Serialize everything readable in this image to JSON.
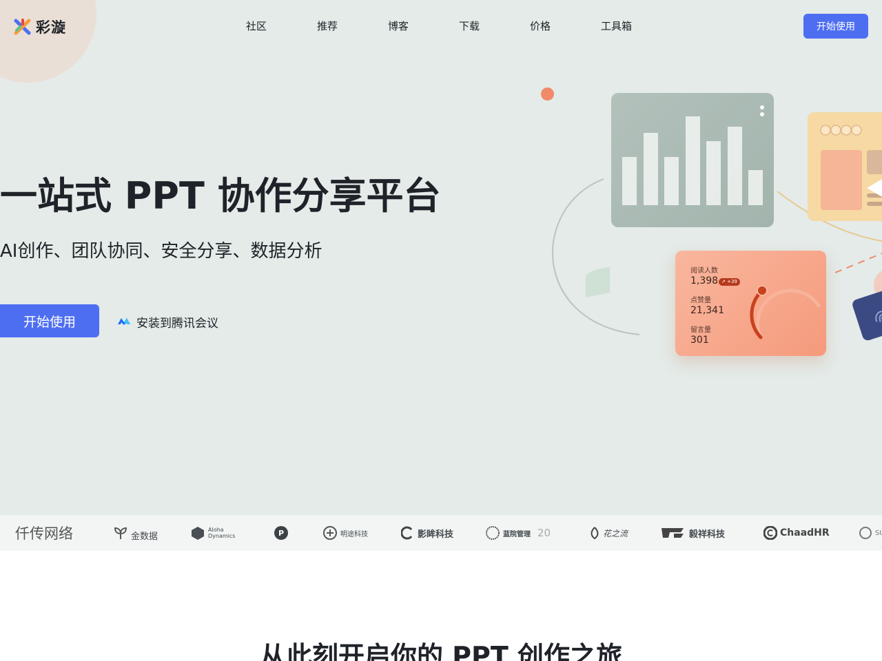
{
  "header": {
    "brand_name": "彩漩",
    "nav": [
      "社区",
      "推荐",
      "博客",
      "下载",
      "价格",
      "工具箱"
    ],
    "cta_label": "开始使用"
  },
  "hero": {
    "title": "一站式 PPT 协作分享平台",
    "subtitle": "AI创作、团队协同、安全分享、数据分析",
    "start_label": "开始使用",
    "install_label": "安装到腾讯会议"
  },
  "stats_card": {
    "reads_label": "阅读人数",
    "reads_value": "1,398",
    "reads_delta": "↗ +39",
    "likes_label": "点赞量",
    "likes_value": "21,341",
    "comments_label": "留言量",
    "comments_value": "301"
  },
  "partners": [
    {
      "name": "仟传网络",
      "icon": "partner-qianchuan-logo"
    },
    {
      "name": "金数据",
      "icon": "partner-jinshuju-logo"
    },
    {
      "name": "Aloha Dynamics",
      "icon": "partner-aloha-logo"
    },
    {
      "name": "",
      "icon": "partner-p-logo"
    },
    {
      "name": "明途科技",
      "icon": "partner-mingtu-logo"
    },
    {
      "name": "影眸科技",
      "icon": "partner-yingmou-logo"
    },
    {
      "name": "蓝院管理",
      "suffix": "20",
      "icon": "partner-lanyuan-logo"
    },
    {
      "name": "花之流",
      "icon": "partner-huazhiliu-logo"
    },
    {
      "name": "毅祥科技",
      "icon": "partner-yixiang-logo"
    },
    {
      "name": "ChaadHR",
      "icon": "partner-chaadhr-logo"
    },
    {
      "name": "SU",
      "icon": "partner-su-logo"
    }
  ],
  "section": {
    "title": "从此刻开启你的 PPT 创作之旅"
  },
  "colors": {
    "accent": "#4e6ef2",
    "hero_bg": "#e4ebe8",
    "stats_card": "#f59a7c"
  }
}
